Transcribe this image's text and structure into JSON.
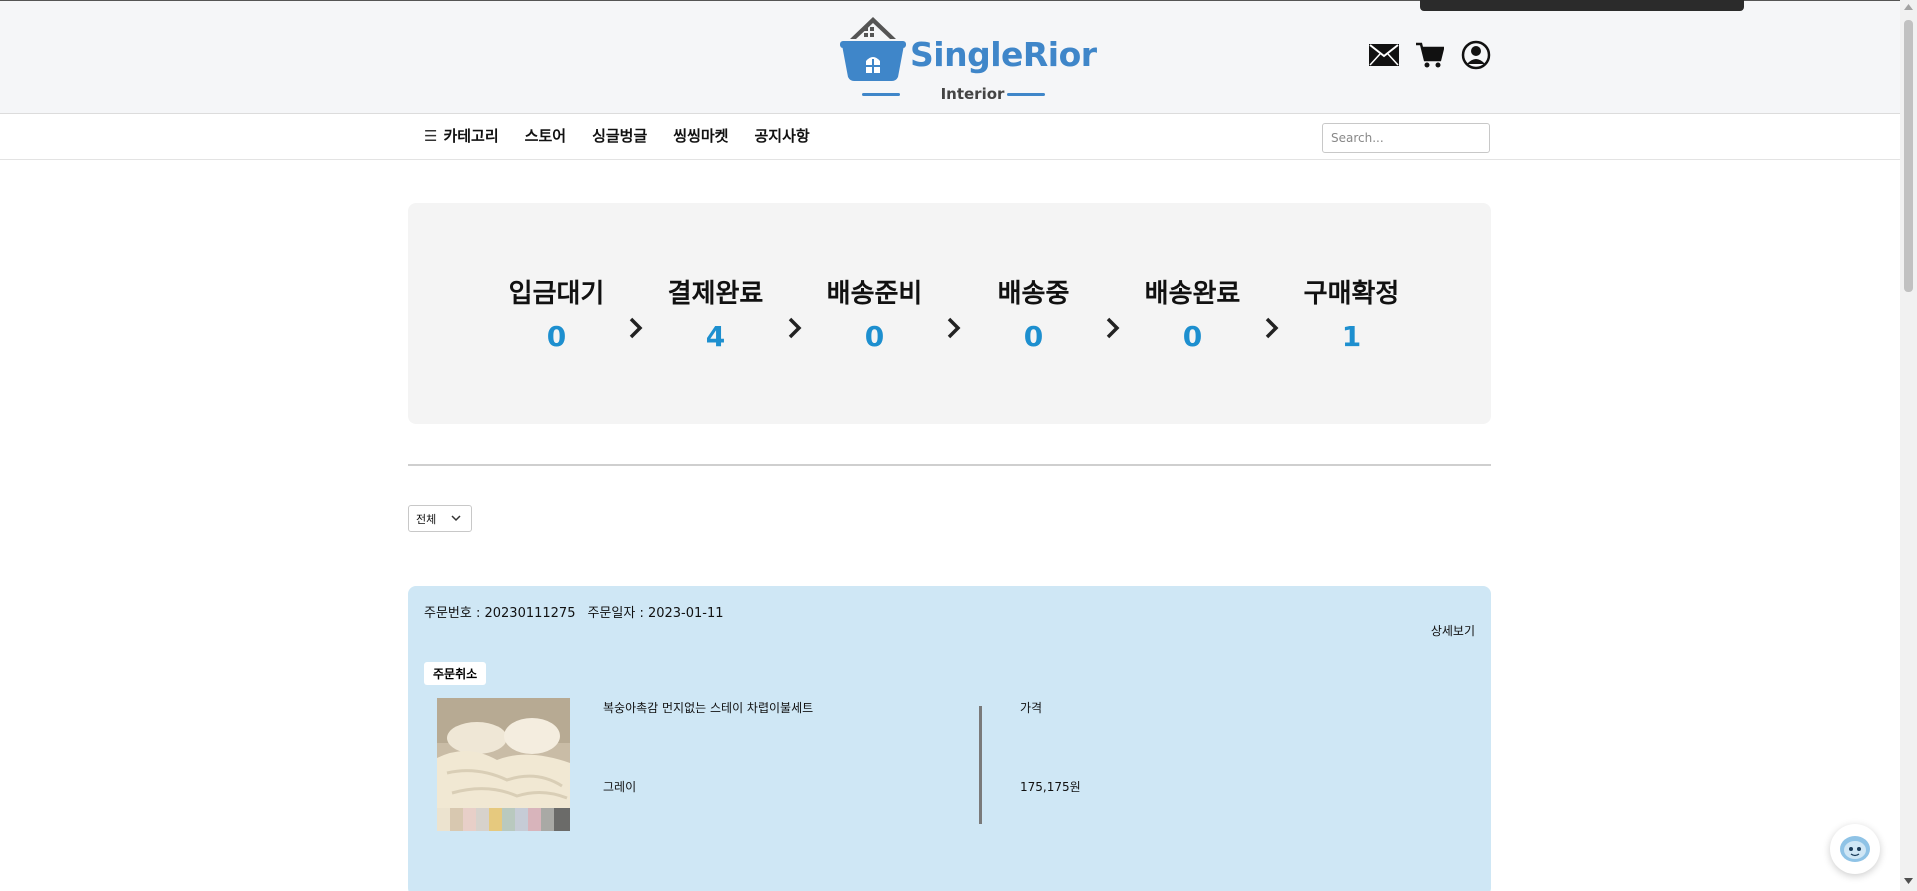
{
  "header": {
    "brand": "SingleRior",
    "brand_sub": "Interior",
    "brand_color": "#3f86c9",
    "icons": [
      "mail-icon",
      "cart-icon",
      "user-icon"
    ]
  },
  "nav": {
    "items": [
      {
        "label": "카테고리",
        "icon": "hamburger-icon"
      },
      {
        "label": "스토어"
      },
      {
        "label": "싱글벙글"
      },
      {
        "label": "씽씽마켓"
      },
      {
        "label": "공지사항"
      }
    ],
    "search_placeholder": "Search..."
  },
  "order_status": {
    "steps": [
      {
        "label": "입금대기",
        "count": "0"
      },
      {
        "label": "결제완료",
        "count": "4"
      },
      {
        "label": "배송준비",
        "count": "0"
      },
      {
        "label": "배송중",
        "count": "0"
      },
      {
        "label": "배송완료",
        "count": "0"
      },
      {
        "label": "구매확정",
        "count": "1"
      }
    ],
    "count_color": "#1d8fcf"
  },
  "filter": {
    "selected": "전체"
  },
  "order": {
    "number_label": "주문번호 : 20230111275",
    "date_label": "주문일자 : 2023-01-11",
    "detail_label": "상세보기",
    "cancel_label": "주문취소",
    "product_name": "복숭아촉감 먼지없는 스테이 차렵이불세트",
    "product_option": "그레이",
    "price_label": "가격",
    "price_value": "175,175원",
    "card_color": "#cfe7f5"
  }
}
